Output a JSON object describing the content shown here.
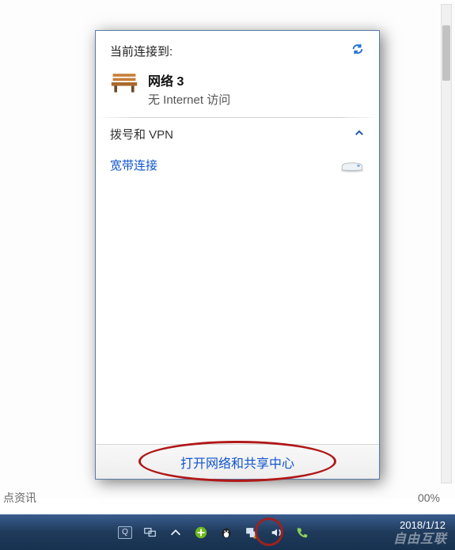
{
  "page": {
    "bottom_left_text": "点资讯",
    "bottom_right_text": "00%"
  },
  "popup": {
    "current_connect_label": "当前连接到:",
    "network": {
      "name": "网络  3",
      "status": "无 Internet 访问"
    },
    "dialup_vpn_label": "拨号和 VPN",
    "broadband_label": "宽带连接",
    "footer_link": "打开网络和共享中心"
  },
  "taskbar": {
    "date": "2018/1/12",
    "watermark": "自由互联"
  },
  "icons": {
    "refresh": "refresh-icon",
    "collapse": "chevron-up-icon",
    "bench": "bench-icon",
    "modem": "modem-icon",
    "qq": "qq-tray-icon",
    "two_screens": "screens-tray-icon",
    "up_arrow": "up-arrow-tray-icon",
    "plus": "plus-tray-icon",
    "penguin": "penguin-tray-icon",
    "network": "network-tray-icon",
    "volume": "volume-tray-icon",
    "phone": "phone-tray-icon"
  }
}
